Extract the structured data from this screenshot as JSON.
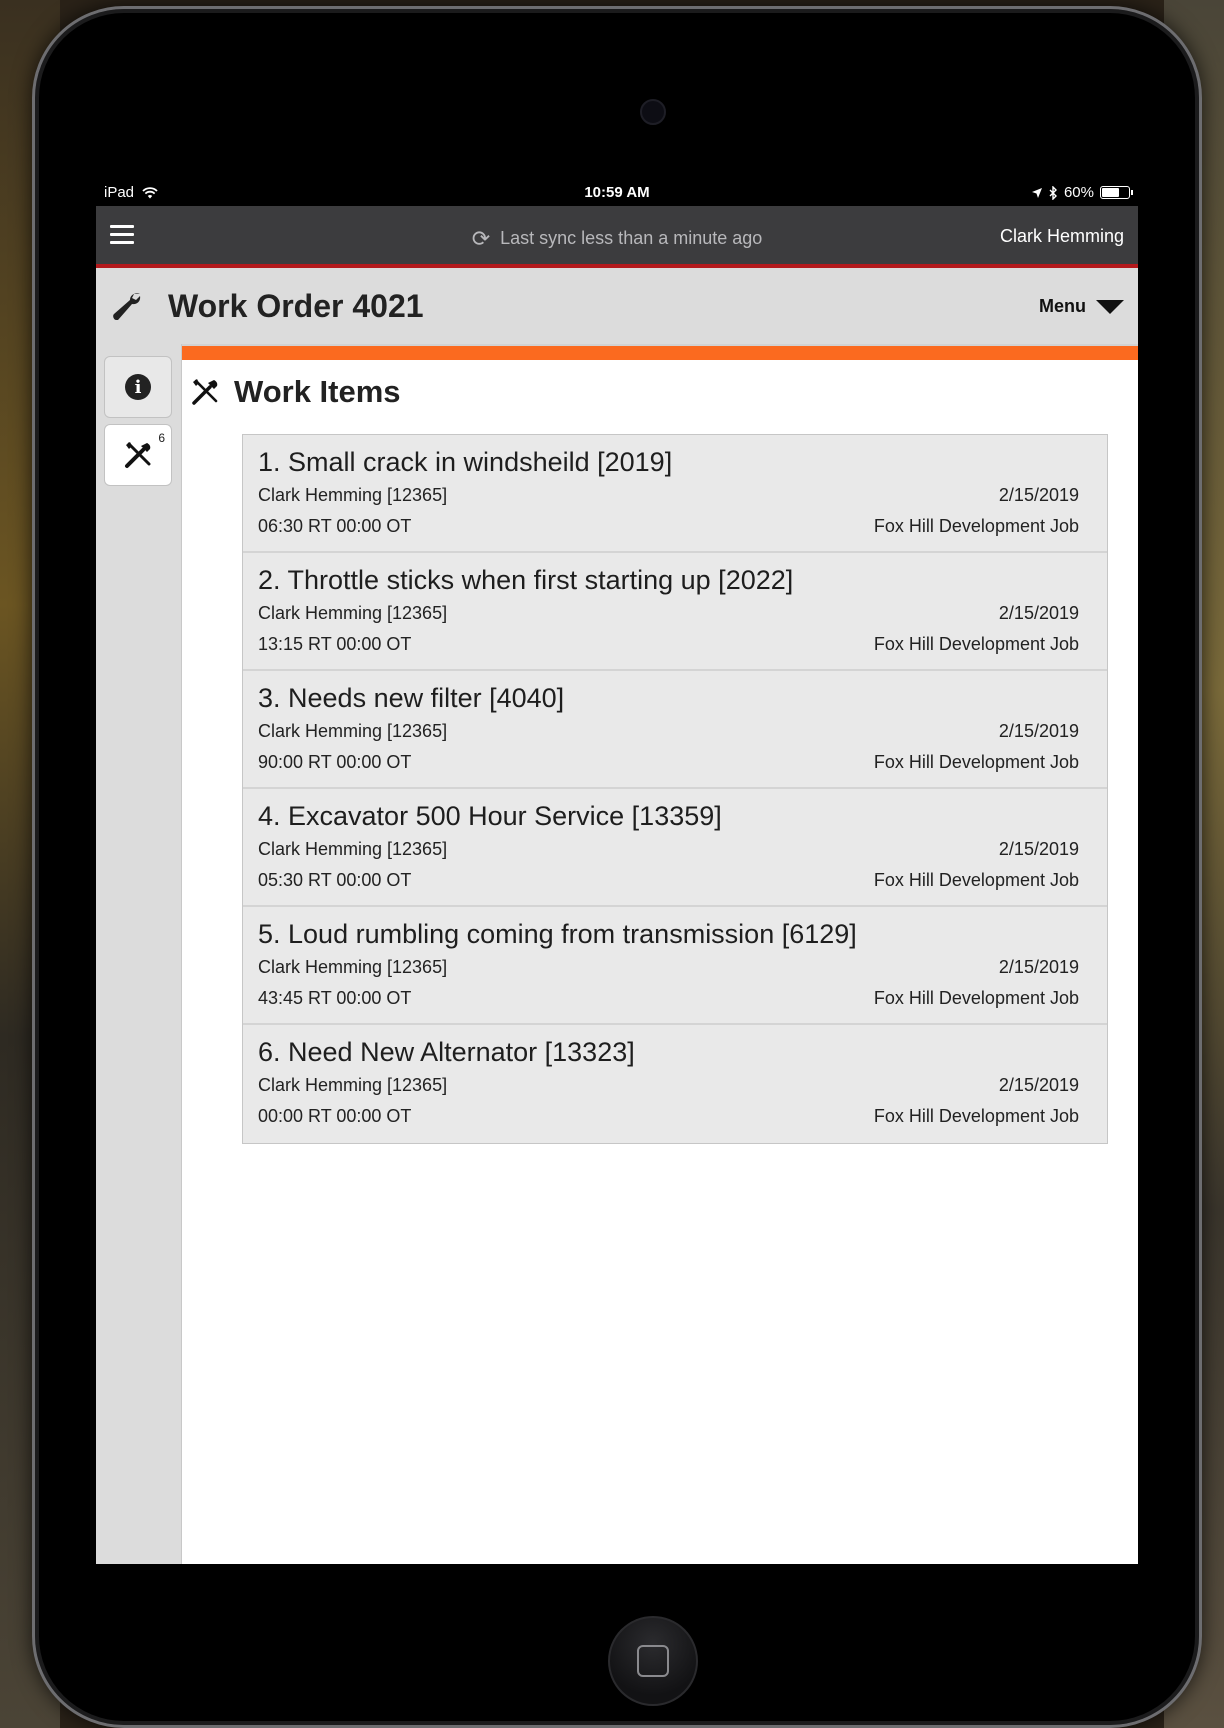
{
  "status_bar": {
    "device": "iPad",
    "time": "10:59 AM",
    "battery": "60%"
  },
  "top_bar": {
    "sync_text": "Last sync less than a minute ago",
    "user_name": "Clark Hemming"
  },
  "header": {
    "title": "Work Order 4021",
    "menu_label": "Menu"
  },
  "side_tabs": {
    "work_items_badge": "6"
  },
  "section": {
    "title": "Work Items"
  },
  "work_items": [
    {
      "title": "1. Small crack in windsheild [2019]",
      "tech": "Clark Hemming [12365]",
      "date": "2/15/2019",
      "hours": "06:30 RT 00:00 OT",
      "job": "Fox Hill Development Job"
    },
    {
      "title": "2. Throttle sticks when first starting up [2022]",
      "tech": "Clark Hemming [12365]",
      "date": "2/15/2019",
      "hours": "13:15 RT 00:00 OT",
      "job": "Fox Hill Development Job"
    },
    {
      "title": "3. Needs new filter [4040]",
      "tech": "Clark Hemming [12365]",
      "date": "2/15/2019",
      "hours": "90:00 RT 00:00 OT",
      "job": "Fox Hill Development Job"
    },
    {
      "title": "4. Excavator 500 Hour Service [13359]",
      "tech": "Clark Hemming [12365]",
      "date": "2/15/2019",
      "hours": "05:30 RT 00:00 OT",
      "job": "Fox Hill Development Job"
    },
    {
      "title": "5. Loud rumbling coming from transmission [6129]",
      "tech": "Clark Hemming [12365]",
      "date": "2/15/2019",
      "hours": "43:45 RT 00:00 OT",
      "job": "Fox Hill Development Job"
    },
    {
      "title": "6. Need New Alternator [13323]",
      "tech": "Clark Hemming [12365]",
      "date": "2/15/2019",
      "hours": "00:00 RT 00:00 OT",
      "job": "Fox Hill Development Job"
    }
  ],
  "colors": {
    "accent_orange": "#fb6a1f",
    "accent_red": "#b3191c",
    "topbar_bg": "#3c3c3e"
  }
}
